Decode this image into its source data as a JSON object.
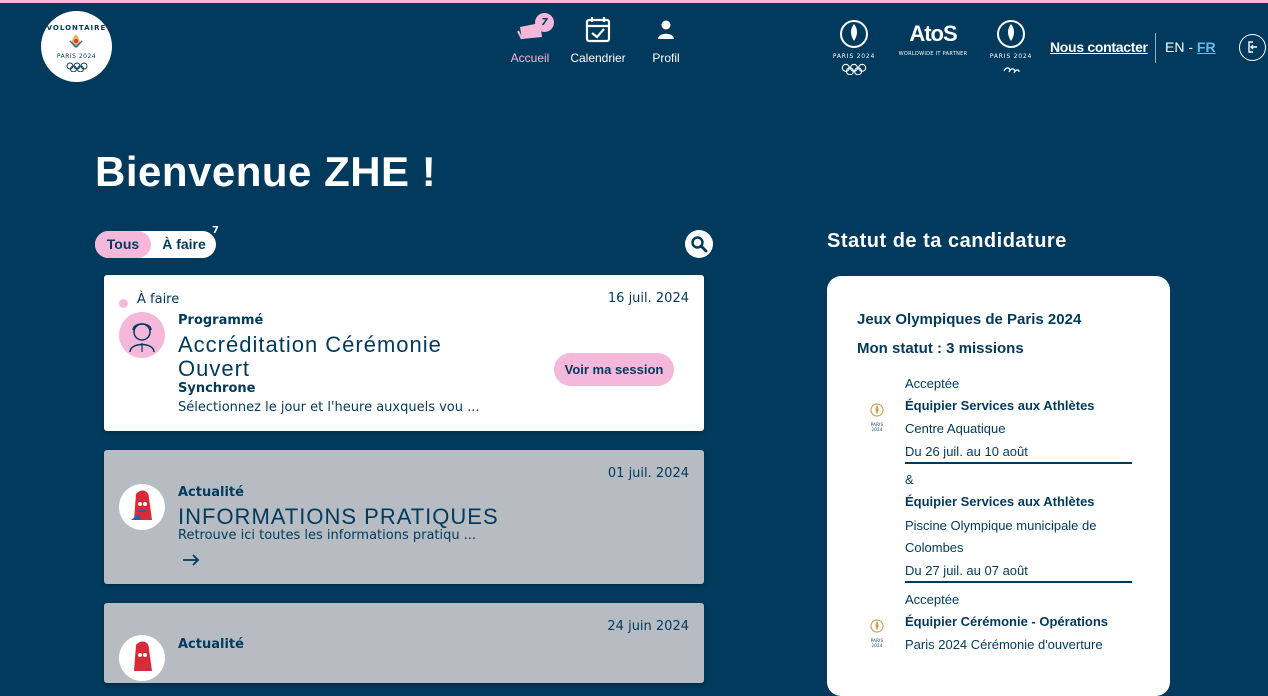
{
  "header": {
    "logo": {
      "top_text": "VOLONTAIRE",
      "bottom_text": "PARIS 2024"
    },
    "nav": [
      {
        "label": "Accueil",
        "badge": "7",
        "icon": "home-cart-icon"
      },
      {
        "label": "Calendrier",
        "icon": "calendar-check-icon"
      },
      {
        "label": "Profil",
        "icon": "user-icon"
      }
    ],
    "sponsors": {
      "olympic": "PARIS 2024",
      "atos": "AtoS",
      "atos_sub": "WORLDWIDE IT PARTNER",
      "paralympic": "PARIS 2024"
    },
    "contact": "Nous contacter",
    "lang": {
      "en": "EN",
      "sep": "-",
      "fr": "FR"
    }
  },
  "welcome": "Bienvenue ZHE !",
  "filters": {
    "all": "Tous",
    "todo": "À faire",
    "todo_count": "7"
  },
  "cards": [
    {
      "status": "À faire",
      "date": "16 juil. 2024",
      "type": "Programmé",
      "title_line1": "Accréditation Cérémonie",
      "title_line2": "Ouvert",
      "mode": "Synchrone",
      "description": "Sélectionnez le jour et l'heure auxquels vou ...",
      "cta": "Voir ma session"
    },
    {
      "date": "01 juil. 2024",
      "type": "Actualité",
      "title": "INFORMATIONS PRATIQUES",
      "description": "Retrouve ici toutes les informations pratiqu ..."
    },
    {
      "date": "24 juin 2024",
      "type": "Actualité"
    }
  ],
  "application_status": {
    "title": "Statut de ta candidature",
    "games": "Jeux Olympiques de Paris 2024",
    "missions": "Mon statut : 3 missions",
    "entries": [
      {
        "state": "Acceptée",
        "role": "Équipier Services aux Athlètes",
        "venue": "Centre Aquatique",
        "dates": "Du 26 juil. au 10 août"
      },
      {
        "state": "&",
        "role": "Équipier Services aux Athlètes",
        "venue_line1": "Piscine Olympique municipale de",
        "venue_line2": "Colombes",
        "dates": "Du 27 juil. au 07 août"
      },
      {
        "state": "Acceptée",
        "role": "Équipier Cérémonie - Opérations",
        "venue": "Paris 2024 Cérémonie d'ouverture"
      }
    ],
    "logo_text": "PARIS 2024"
  },
  "colors": {
    "background": "#013a5c",
    "accent_pink": "#f6b8da",
    "link_blue": "#69b8ec",
    "card_grey": "#b7bcc2"
  }
}
